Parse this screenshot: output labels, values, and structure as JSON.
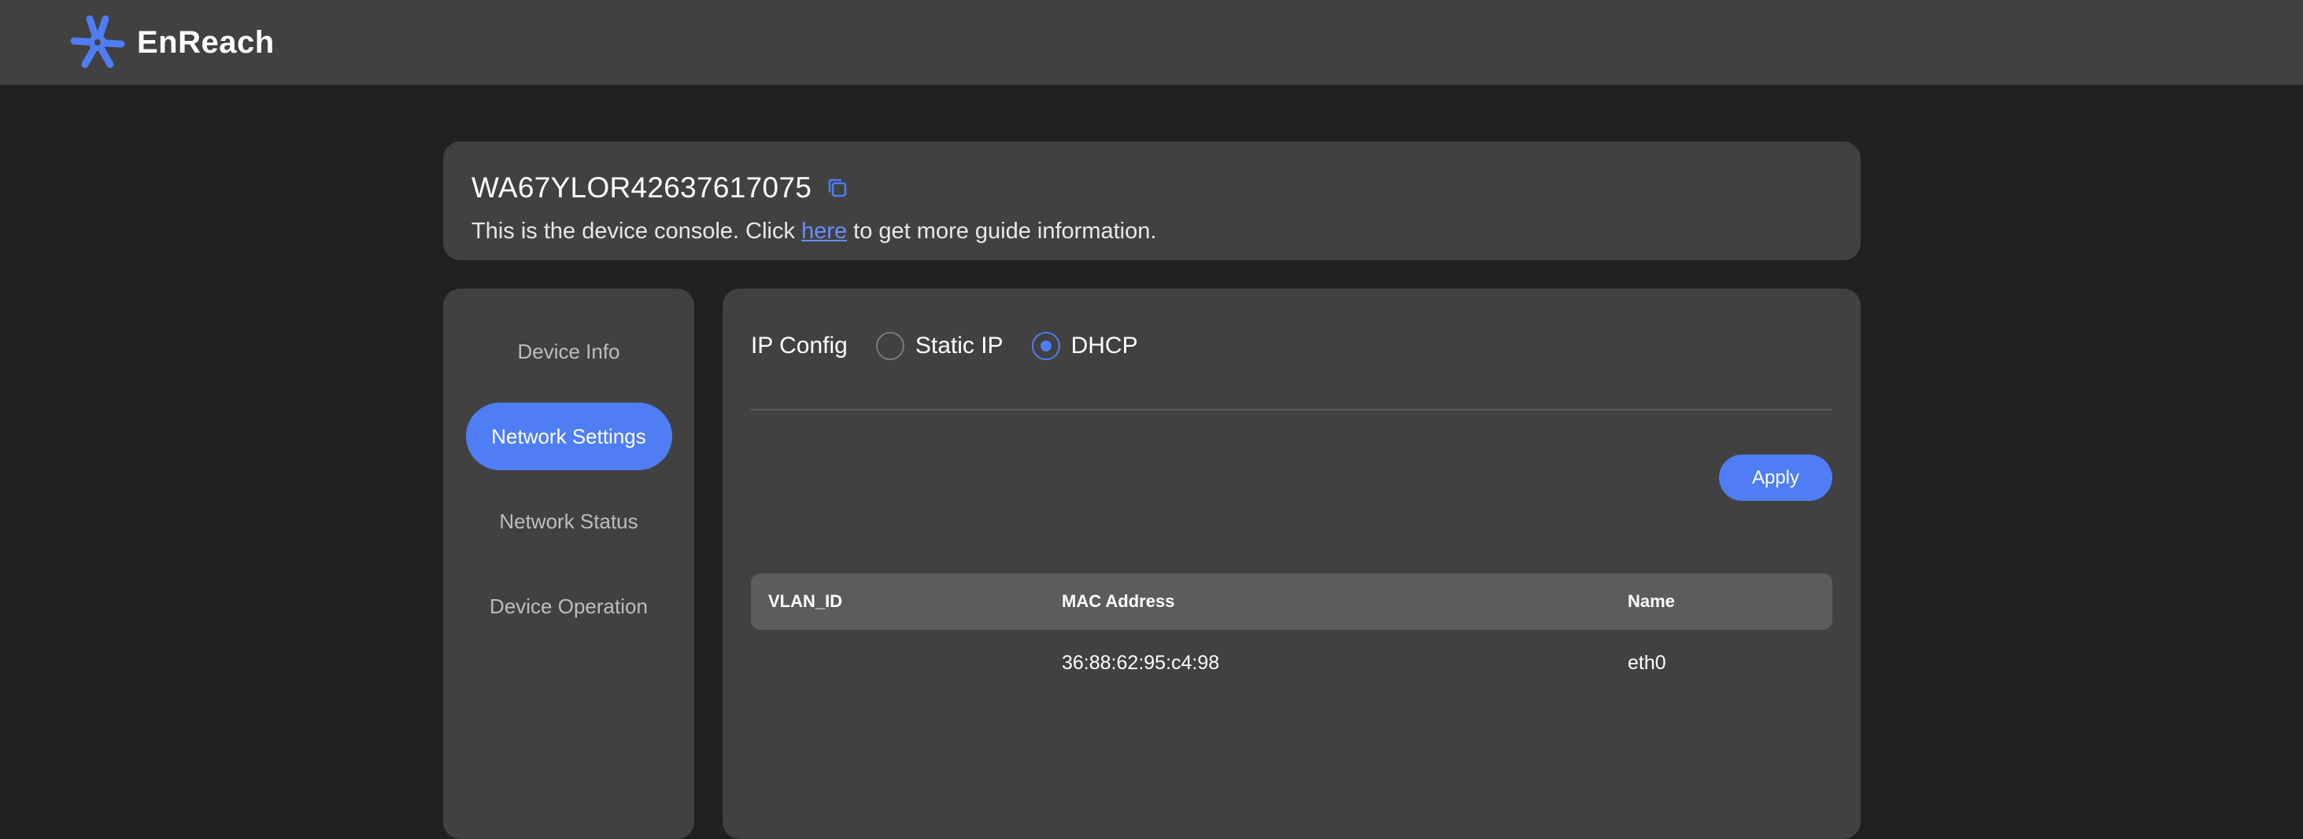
{
  "app": {
    "brand": "EnReach",
    "brand_color": "#4f7df3",
    "logo_icon": "enreach-logo-icon"
  },
  "header": {
    "device_id": "WA67YLOR42637617075",
    "copy_icon": "copy-icon",
    "desc_prefix": "This is the device console. Click ",
    "desc_link": "here",
    "desc_suffix": " to get more guide information."
  },
  "sidebar": {
    "items": [
      {
        "label": "Device Info",
        "active": false
      },
      {
        "label": "Network Settings",
        "active": true
      },
      {
        "label": "Network Status",
        "active": false
      },
      {
        "label": "Device Operation",
        "active": false
      }
    ]
  },
  "ip_config": {
    "label": "IP Config",
    "options": [
      {
        "label": "Static IP",
        "checked": false
      },
      {
        "label": "DHCP",
        "checked": true
      }
    ]
  },
  "actions": {
    "apply_label": "Apply"
  },
  "table": {
    "columns": [
      "VLAN_ID",
      "MAC Address",
      "Name"
    ],
    "rows": [
      [
        "",
        "36:88:62:95:c4:98",
        "eth0"
      ]
    ]
  }
}
